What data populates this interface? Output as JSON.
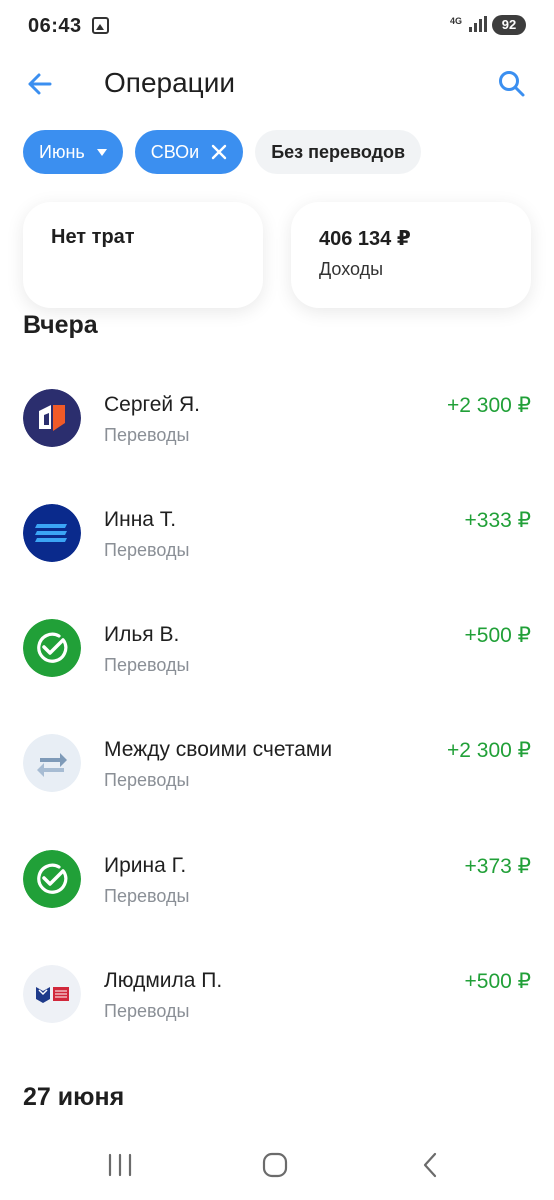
{
  "status": {
    "time": "06:43",
    "network": "4G",
    "battery": "92"
  },
  "header": {
    "title": "Операции"
  },
  "filters": {
    "month": "Июнь",
    "category": "СВОи",
    "no_transfers": "Без переводов"
  },
  "summary": {
    "spend": {
      "title": "Нет трат"
    },
    "income": {
      "title": "406 134 ₽",
      "label": "Доходы"
    }
  },
  "sections": [
    {
      "title": "Вчера",
      "operations": [
        {
          "name": "Сергей Я.",
          "category": "Переводы",
          "amount": "+2 300 ₽",
          "icon": "bank-logo-icon"
        },
        {
          "name": "Инна Т.",
          "category": "Переводы",
          "amount": "+333 ₽",
          "icon": "bank-logo-icon"
        },
        {
          "name": "Илья В.",
          "category": "Переводы",
          "amount": "+500 ₽",
          "icon": "sber-logo-icon"
        },
        {
          "name": "Между своими счетами",
          "category": "Переводы",
          "amount": "+2 300 ₽",
          "icon": "transfer-arrows-icon"
        },
        {
          "name": "Ирина Г.",
          "category": "Переводы",
          "amount": "+373 ₽",
          "icon": "sber-logo-icon"
        },
        {
          "name": "Людмила П.",
          "category": "Переводы",
          "amount": "+500 ₽",
          "icon": "pochta-bank-logo-icon"
        }
      ]
    },
    {
      "title": "27 июня"
    }
  ],
  "colors": {
    "accent": "#3b8ff0",
    "income": "#21a038",
    "secondary_text": "#8a8f96"
  }
}
